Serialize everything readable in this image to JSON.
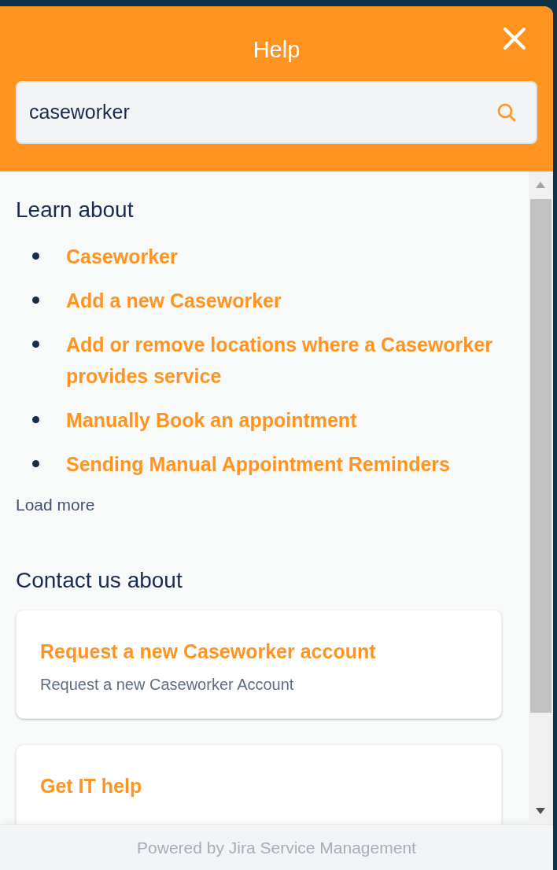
{
  "header": {
    "title": "Help",
    "search": {
      "value": "caseworker"
    }
  },
  "learn": {
    "heading": "Learn about",
    "articles": [
      "Caseworker",
      "Add a new Caseworker",
      "Add or remove locations where a Caseworker provides service",
      "Manually Book an appointment",
      "Sending Manual Appointment Reminders"
    ],
    "load_more": "Load more"
  },
  "contact": {
    "heading": "Contact us about",
    "requests": [
      {
        "title": "Request a new Caseworker account",
        "description": "Request a new Caseworker Account"
      },
      {
        "title": "Get IT help"
      }
    ]
  },
  "footer": "Powered by Jira Service Management"
}
